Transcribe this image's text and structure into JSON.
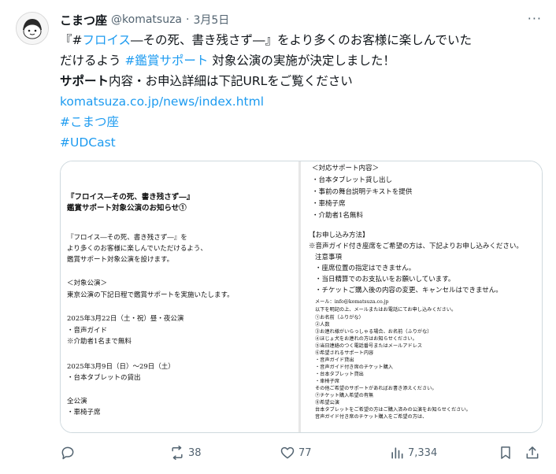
{
  "author": {
    "display_name": "こまつ座",
    "handle": "@komatsuza",
    "separator": "·",
    "date": "3月5日",
    "avatar_label": "こまつ座"
  },
  "tweet": {
    "line1_pre": "『#",
    "line1_hashtag": "フロイス",
    "line1_post": "―その死、書き残さず―』をより多くのお客様に楽しんでいた",
    "line2_pre": "だけるよう ",
    "line2_hashtag": "#鑑賞サポート",
    "line2_post": " 対象公演の実施が決定しました！",
    "line3_bold": "サポート",
    "line3_rest": "内容・お申込詳細は下記URLをご覧ください",
    "url": "komatsuza.co.jp/news/index.html",
    "tag_komatsuza": "#こまつ座",
    "tag_udcast": "#UDCast"
  },
  "notice_left": [
    {
      "text": "『フロイス―その死、書き残さず―』",
      "big": true
    },
    {
      "text": "鑑賞サポート対象公演のお知らせ①",
      "big": true
    },
    {
      "text": "『フロイス―その死、書き残さず―』を"
    },
    {
      "text": "より多くのお客様に楽しんでいただけるよう、"
    },
    {
      "text": "鑑賞サポート対象公演を設けます。"
    },
    {
      "text": "＜対象公演＞"
    },
    {
      "text": "東京公演の下記日程で鑑賞サポートを実施いたします。"
    },
    {
      "text": "2025年3月22日（土・祝）昼・夜公演"
    },
    {
      "text": "・音声ガイド"
    },
    {
      "text": "※介助者1名まで無料"
    },
    {
      "text": "2025年3月9日（日）〜29日（土）"
    },
    {
      "text": "・台本タブレットの貸出"
    },
    {
      "text": "全公演"
    },
    {
      "text": "・車椅子席"
    }
  ],
  "notice_right": [
    {
      "text": "＜対応サポート内容＞"
    },
    {
      "text": "・台本タブレット貸し出し"
    },
    {
      "text": "・事前の舞台説明テキストを提供"
    },
    {
      "text": "・車椅子席"
    },
    {
      "text": "・介助者1名無料"
    },
    {
      "text": "【お申し込み方法】"
    },
    {
      "text": "※音声ガイド付き座席をご希望の方は、下記よりお申し込みください。"
    },
    {
      "text": "注意事項"
    },
    {
      "text": "・座席位置の指定はできません。"
    },
    {
      "text": "・当日精算でのお支払いをお願いしています。"
    },
    {
      "text": "・チケットご購入後の内容の変更、キャンセルはできません。"
    },
    {
      "text": "メール：info@komatsuza.co.jp",
      "tiny": true
    },
    {
      "text": "以下を明記の上、メールまたはお電話にてお申し込みください。",
      "tiny": true
    },
    {
      "text": "①お名前（ふりがな）",
      "tiny": true
    },
    {
      "text": "②人数",
      "tiny": true
    },
    {
      "text": "③お連れ様がいらっしゃる場合、お名前（ふりがな）",
      "tiny": true
    },
    {
      "text": "④ほじょ犬をお連れの方はお知らせください。",
      "tiny": true
    },
    {
      "text": "⑤当日連絡のつく電話番号またはメールアドレス",
      "tiny": true
    },
    {
      "text": "⑥希望されるサポート内容",
      "tiny": true
    },
    {
      "text": "・音声ガイド貸出",
      "tiny": true
    },
    {
      "text": "・音声ガイド付き席のチケット購入",
      "tiny": true
    },
    {
      "text": "・台本タブレット貸出",
      "tiny": true
    },
    {
      "text": "・車椅子席",
      "tiny": true
    },
    {
      "text": "その他ご希望のサポートがあればお書き添えください。",
      "tiny": true
    },
    {
      "text": "⑦チケット購入希望の有無",
      "tiny": true
    },
    {
      "text": "⑧希望公演",
      "tiny": true
    },
    {
      "text": "台本タブレットをご希望の方はご購入済みの公演をお知らせください。",
      "tiny": true
    },
    {
      "text": "音声ガイド付き席のチケット購入をご希望の方は、",
      "tiny": true
    }
  ],
  "actions": {
    "reply_count": "",
    "repost_count": "38",
    "like_count": "77",
    "views_count": "7,334"
  },
  "colors": {
    "link": "#1d9bf0",
    "muted": "#536471"
  }
}
